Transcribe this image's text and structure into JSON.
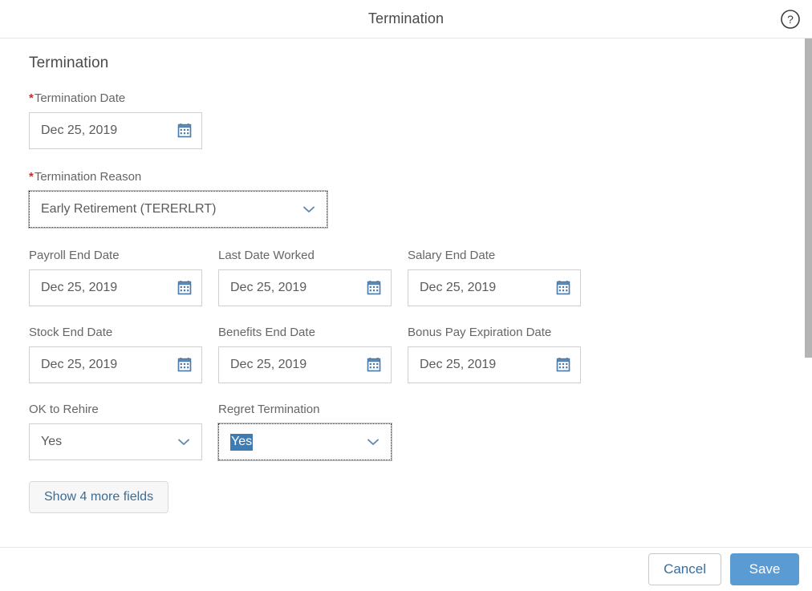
{
  "header": {
    "title": "Termination",
    "help_icon": "help-circle-icon"
  },
  "form": {
    "section_title": "Termination",
    "required_marker": "*",
    "termination_date": {
      "label": "Termination Date",
      "required": true,
      "value": "Dec 25, 2019",
      "icon": "calendar-icon"
    },
    "termination_reason": {
      "label": "Termination Reason",
      "required": true,
      "value": "Early Retirement (TERERLRT)",
      "icon": "chevron-down-icon",
      "focused": true
    },
    "row_dates_1": [
      {
        "label": "Payroll End Date",
        "value": "Dec 25, 2019",
        "icon": "calendar-icon"
      },
      {
        "label": "Last Date Worked",
        "value": "Dec 25, 2019",
        "icon": "calendar-icon"
      },
      {
        "label": "Salary End Date",
        "value": "Dec 25, 2019",
        "icon": "calendar-icon"
      }
    ],
    "row_dates_2": [
      {
        "label": "Stock End Date",
        "value": "Dec 25, 2019",
        "icon": "calendar-icon"
      },
      {
        "label": "Benefits End Date",
        "value": "Dec 25, 2019",
        "icon": "calendar-icon"
      },
      {
        "label": "Bonus Pay Expiration Date",
        "value": "Dec 25, 2019",
        "icon": "calendar-icon"
      }
    ],
    "row_selects": [
      {
        "label": "OK to Rehire",
        "value": "Yes",
        "icon": "chevron-down-icon",
        "focused": false
      },
      {
        "label": "Regret Termination",
        "value": "Yes",
        "icon": "chevron-down-icon",
        "focused": true,
        "text_selected": true
      }
    ],
    "show_more_label": "Show 4 more fields"
  },
  "footer": {
    "cancel_label": "Cancel",
    "save_label": "Save"
  },
  "scrollbar": {
    "orientation": "vertical",
    "thumb_position_pct": 0,
    "thumb_size_pct": 63
  },
  "colors": {
    "accent_blue": "#5a9bd4",
    "link_blue": "#3c6c94",
    "required_red": "#e4221f",
    "selection_blue": "#3f7cb4",
    "border_gray": "#d0d0d0",
    "label_gray": "#666666",
    "scrollbar_gray": "#b4b4b4"
  }
}
